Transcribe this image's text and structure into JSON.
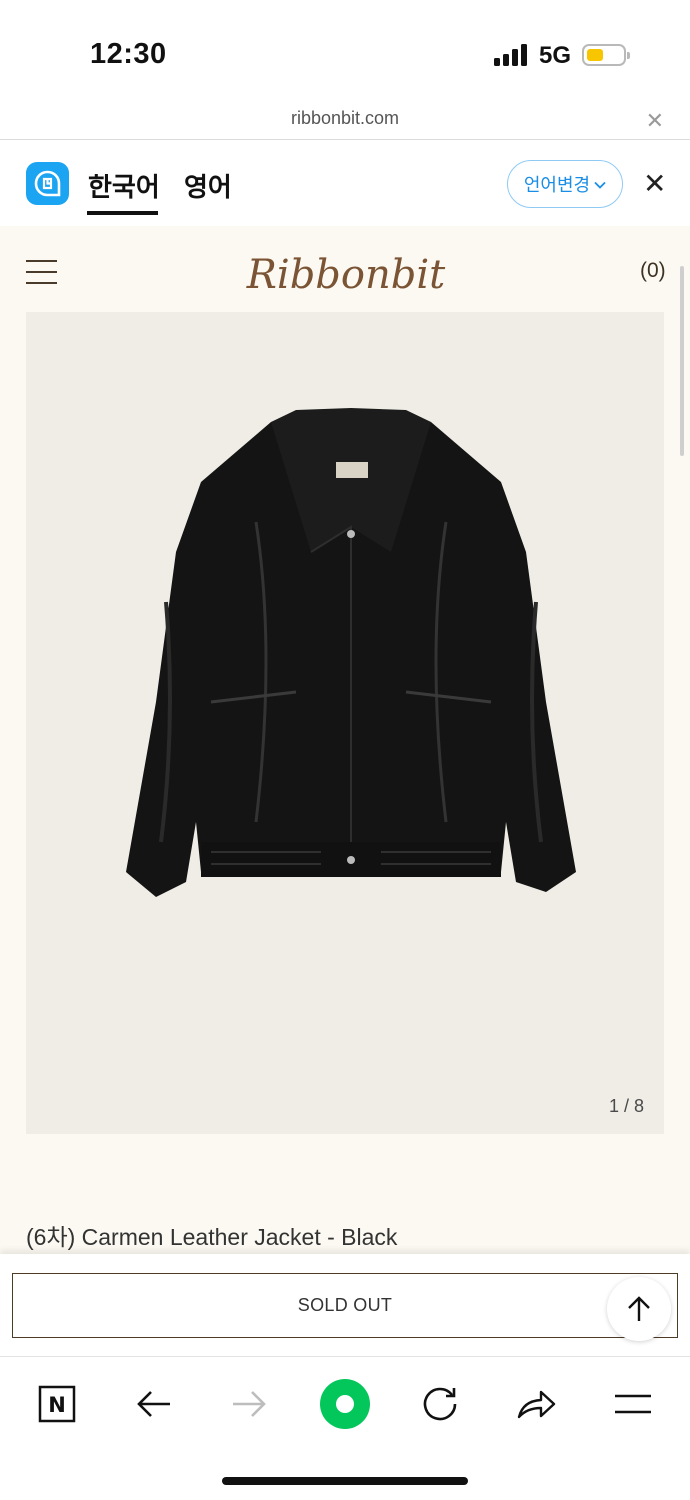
{
  "status_bar": {
    "time": "12:30",
    "network": "5G",
    "battery_level": 0.45,
    "battery_color": "#f7c600"
  },
  "url_bar": {
    "url": "ribbonbit.com",
    "close_icon": "close-icon"
  },
  "translate_bar": {
    "app_icon": "papago-icon",
    "tabs": [
      {
        "label": "한국어",
        "selected": true
      },
      {
        "label": "영어",
        "selected": false
      }
    ],
    "change_language_label": "언어변경",
    "accent_color": "#1a8ee6"
  },
  "site": {
    "logo_text": "Ribbonbit",
    "cart_count": "(0)",
    "menu_icon": "hamburger-icon",
    "background": "#fbf9f1"
  },
  "product": {
    "image_counter_current": "1",
    "image_counter_separator": " / ",
    "image_counter_total": "8",
    "title": "(6차) Carmen Leather Jacket - Black"
  },
  "purchase_bar": {
    "sold_out_label": "SOLD OUT",
    "scroll_top_icon": "arrow-up-icon",
    "border_color": "#4e3b26"
  },
  "toolbar": {
    "items": [
      {
        "icon": "naver-home-icon",
        "label": "N"
      },
      {
        "icon": "back-arrow-icon"
      },
      {
        "icon": "forward-arrow-icon"
      },
      {
        "icon": "green-dot-icon",
        "color": "#03c75a"
      },
      {
        "icon": "refresh-icon"
      },
      {
        "icon": "share-icon"
      },
      {
        "icon": "menu-icon"
      }
    ]
  }
}
